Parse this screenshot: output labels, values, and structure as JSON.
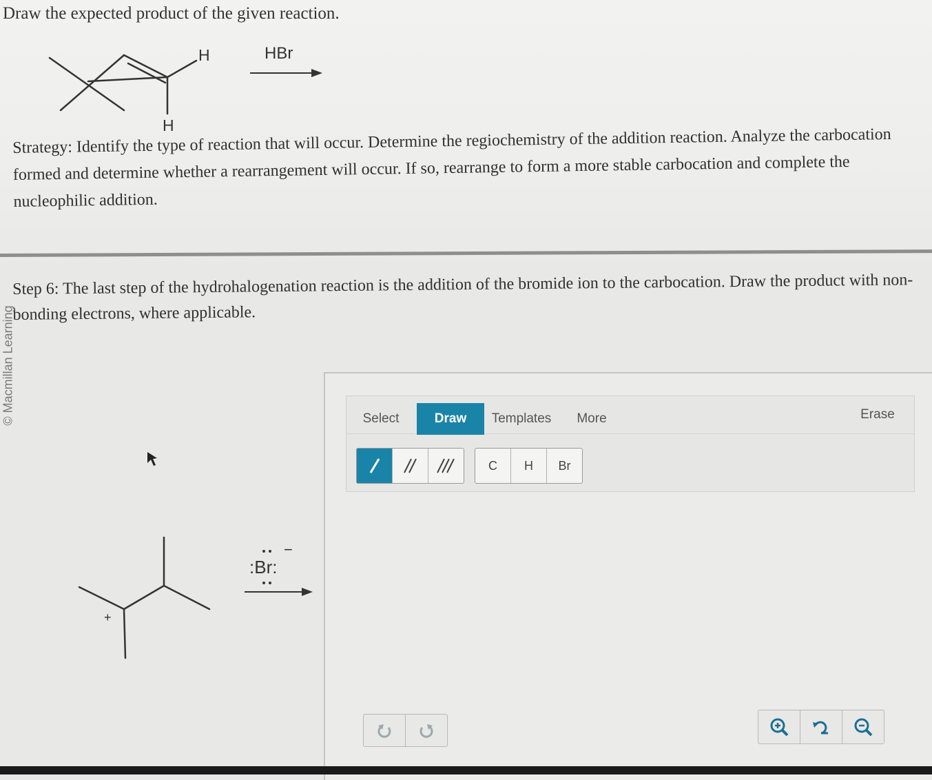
{
  "question": "Draw the expected product of the given reaction.",
  "reactant": {
    "h_top": "H",
    "h_bottom": "H",
    "reagent": "HBr"
  },
  "strategy": "Strategy: Identify the type of reaction that will occur. Determine the regiochemistry of the addition reaction. Analyze the carbocation formed and determine whether a rearrangement will occur. If so, rearrange to form a more stable carbocation and complete the nucleophilic addition.",
  "step": "Step 6: The last step of the hydrohalogenation reaction is the addition of the bromide ion to the carbocation. Draw the product with non-bonding electrons, where applicable.",
  "copyright": "© Macmillan Learning",
  "step_scheme": {
    "charge_plus": "+",
    "bromide_label": ":Br:",
    "bromide_charge": "−"
  },
  "editor": {
    "tabs": [
      "Select",
      "Draw",
      "Templates",
      "More"
    ],
    "active_tab": "Draw",
    "erase_label": "Erase",
    "bond_buttons": [
      "single-bond",
      "double-bond",
      "triple-bond"
    ],
    "atom_buttons": [
      "C",
      "H",
      "Br"
    ],
    "accent_color": "#1a84a8"
  }
}
